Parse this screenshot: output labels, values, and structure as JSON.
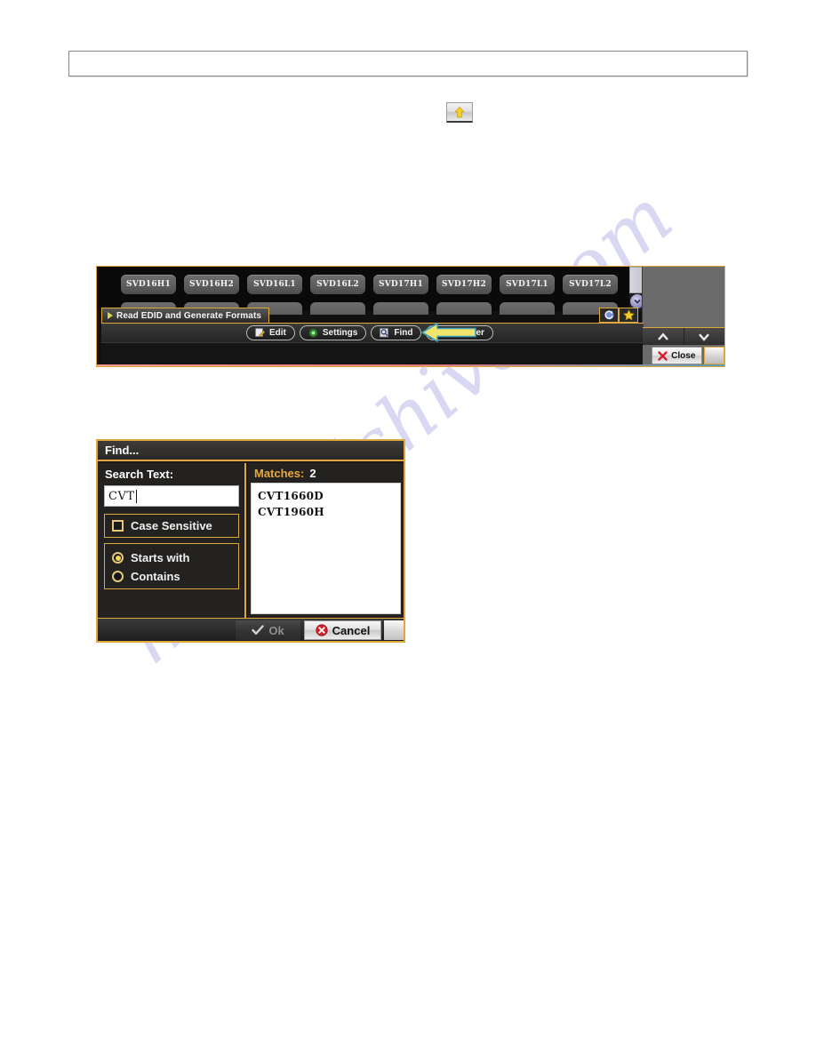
{
  "page": {
    "watermark": "manualshive.com"
  },
  "top_bar": {
    "value": "",
    "placeholder": ""
  },
  "star_button": {
    "icon": "yellow-star-arrow-up-icon"
  },
  "app_window": {
    "svd_tabs": [
      {
        "label": "SVD16H1"
      },
      {
        "label": "SVD16H2"
      },
      {
        "label": "SVD16L1"
      },
      {
        "label": "SVD16L2"
      },
      {
        "label": "SVD17H1"
      },
      {
        "label": "SVD17H2"
      },
      {
        "label": "SVD17L1"
      },
      {
        "label": "SVD17L2"
      }
    ],
    "section_tab": {
      "label": "Read EDID and Generate Formats",
      "icon": "play-triangle-icon"
    },
    "header_icons": [
      {
        "name": "refresh-icon"
      },
      {
        "name": "star-icon"
      }
    ],
    "scrollbar": {
      "down_icon": "chevron-down-icon"
    },
    "toolbar": {
      "buttons": [
        {
          "label": "Edit",
          "icon": "pencil-edit-icon"
        },
        {
          "label": "Settings",
          "icon": "green-gear-icon"
        },
        {
          "label": "Find",
          "icon": "magnifier-icon"
        },
        {
          "label": "Transfer",
          "icon": "transfer-icon"
        }
      ]
    },
    "side_controls": {
      "up_label": "∧",
      "down_label": "∨",
      "close_label": "Close",
      "close_icon": "red-x-icon"
    },
    "pointer_arrow": {
      "name": "yellow-callout-arrow",
      "points_at": "Find",
      "fill": "#f2e46a",
      "stroke": "#3aa0c0"
    }
  },
  "find_dialog": {
    "title": "Find...",
    "search_label": "Search Text:",
    "search_value": "CVT",
    "search_placeholder": "",
    "case_sensitive": {
      "label": "Case Sensitive",
      "checked": false
    },
    "match_mode": {
      "options": [
        {
          "label": "Starts with",
          "selected": true
        },
        {
          "label": "Contains",
          "selected": false
        }
      ]
    },
    "matches_label": "Matches:",
    "matches_count": "2",
    "results": [
      {
        "label": "CVT1660D"
      },
      {
        "label": "CVT1960H"
      }
    ],
    "buttons": {
      "ok_label": "Ok",
      "ok_icon": "check-icon",
      "ok_enabled": false,
      "cancel_label": "Cancel",
      "cancel_icon": "red-x-circle-icon"
    }
  },
  "colors": {
    "accent_gold": "#e0a83c",
    "dialog_bg": "#232220",
    "window_bg": "#0a0a0a",
    "arrow_yellow": "#f2e46a"
  }
}
